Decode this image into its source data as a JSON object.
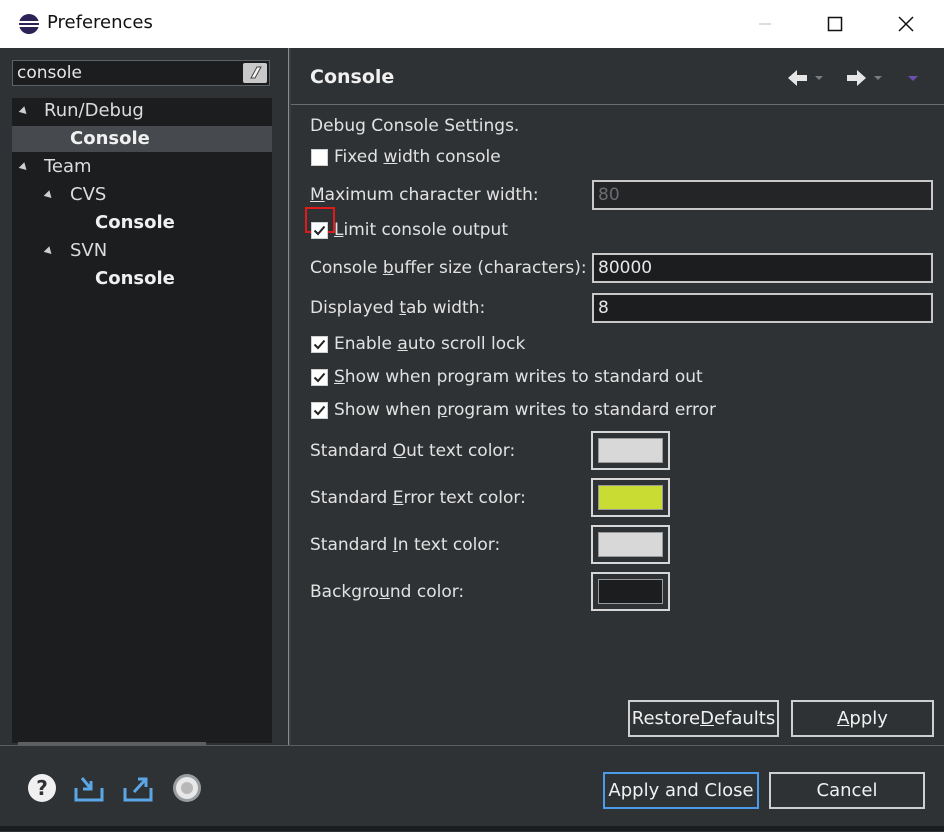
{
  "window": {
    "title": "Preferences",
    "controls": {
      "minimize": "minimize-icon",
      "maximize": "maximize-icon",
      "close": "close-icon"
    }
  },
  "filter": {
    "value": "console",
    "clear_icon": "eraser-icon"
  },
  "tree": [
    {
      "label": "Run/Debug",
      "level": 0,
      "expanded": true,
      "bold": false
    },
    {
      "label": "Console",
      "level": 1,
      "bold": true,
      "selected": true
    },
    {
      "label": "Team",
      "level": 0,
      "expanded": true,
      "bold": false
    },
    {
      "label": "CVS",
      "level": 1,
      "expanded": true,
      "bold": false
    },
    {
      "label": "Console",
      "level": 2,
      "bold": true
    },
    {
      "label": "SVN",
      "level": 1,
      "expanded": true,
      "bold": false
    },
    {
      "label": "Console",
      "level": 2,
      "bold": true
    }
  ],
  "page": {
    "title": "Console",
    "nav_icons": [
      "back-arrow-icon",
      "forward-arrow-icon",
      "view-menu-icon"
    ]
  },
  "settings": {
    "section_label": "Debug Console Settings.",
    "fixed_width": {
      "label_pre": "Fixed ",
      "label_u": "w",
      "label_post": "idth console",
      "checked": false
    },
    "max_char_width": {
      "label_pre": "",
      "label_u": "M",
      "label_post": "aximum character width:",
      "value": "80",
      "enabled": false
    },
    "limit_output": {
      "label_pre": "",
      "label_u": "L",
      "label_post": "imit console output",
      "checked": true
    },
    "buffer_size": {
      "label_pre": "Console ",
      "label_u": "b",
      "label_post": "uffer size (characters):",
      "value": "80000"
    },
    "tab_width": {
      "label_pre": "Displayed ",
      "label_u": "t",
      "label_post": "ab width:",
      "value": "8"
    },
    "auto_scroll": {
      "label_pre": "Enable ",
      "label_u": "a",
      "label_post": "uto scroll lock",
      "checked": true
    },
    "show_std_out": {
      "label_pre": "",
      "label_u": "S",
      "label_post": "how when program writes to standard out",
      "checked": true
    },
    "show_std_err": {
      "label_pre": "Show when ",
      "label_u": "p",
      "label_post": "rogram writes to standard error",
      "checked": true
    },
    "colors": [
      {
        "label_pre": "Standard ",
        "label_u": "O",
        "label_post": "ut text color:",
        "color": "#d8d8d8"
      },
      {
        "label_pre": "Standard ",
        "label_u": "E",
        "label_post": "rror text color:",
        "color": "#c9dc33"
      },
      {
        "label_pre": "Standard ",
        "label_u": "I",
        "label_post": "n text color:",
        "color": "#d8d8d8"
      },
      {
        "label_pre": "Backgro",
        "label_u": "u",
        "label_post": "nd color:",
        "color": "#1b1d1f"
      }
    ]
  },
  "buttons": {
    "restore_pre": "Restore ",
    "restore_u": "D",
    "restore_post": "efaults",
    "apply_pre": "",
    "apply_u": "A",
    "apply_post": "pply",
    "apply_close": "Apply and Close",
    "cancel": "Cancel"
  },
  "footer_icons": [
    "help-icon",
    "import-icon",
    "export-icon",
    "oomph-record-icon"
  ],
  "colors": {
    "accent": "#4c9be8",
    "highlight": "#e01b1b"
  }
}
